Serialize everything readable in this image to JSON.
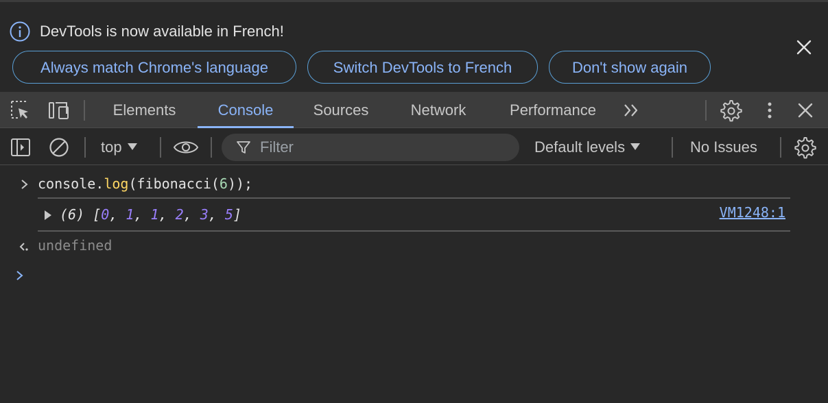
{
  "infobar": {
    "message": "DevTools is now available in French!",
    "buttons": {
      "always_match": "Always match Chrome's language",
      "switch": "Switch DevTools to French",
      "dont_show": "Don't show again"
    }
  },
  "tabs": [
    {
      "label": "Elements"
    },
    {
      "label": "Console"
    },
    {
      "label": "Sources"
    },
    {
      "label": "Network"
    },
    {
      "label": "Performance"
    }
  ],
  "toolbar": {
    "context": "top",
    "filter_placeholder": "Filter",
    "levels": "Default levels",
    "issues": "No Issues"
  },
  "console": {
    "input": {
      "obj": "console",
      "dot": ".",
      "method": "log",
      "open": "(fibonacci(",
      "arg": "6",
      "close": "));"
    },
    "output": {
      "count": "(6)",
      "open": "[",
      "values": [
        "0",
        "1",
        "1",
        "2",
        "3",
        "5"
      ],
      "close": "]",
      "source": "VM1248:1"
    },
    "result": "undefined"
  },
  "colors": {
    "accent": "#8ab4f8",
    "function": "#fdd663",
    "number": "#9a7ffd",
    "background": "#282828",
    "toolbar": "#3c3c3c"
  }
}
